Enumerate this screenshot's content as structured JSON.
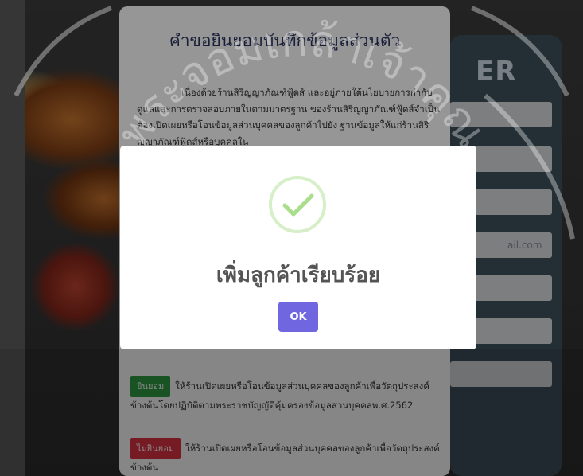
{
  "register": {
    "title": "ER",
    "email_partial": "ail.com"
  },
  "consent": {
    "title": "คำขอยินยอมบันทึกข้อมูลส่วนตัว",
    "body": "เนื่องด้วยร้านสิริญญาภัณฑ์ฟู้ดส์ และอยู่ภายใต้นโยบายการกำกับดูแลและการตรวจสอบภายในตามมาตรฐาน ของร้านสิริญญาภัณฑ์ฟู้ดส์จำเป็นต้องเปิดเผยหรือโอนข้อมูลส่วนบุคคลของลูกค้าไปยัง ฐานข้อมูลให้แก่ร้านสิริญญาภัณฑ์ฟู้ดส์หรือบุคคลใน",
    "agree_label": "ยินยอม",
    "agree_text": "ให้ร้านเปิดเผยหรือโอนข้อมูลส่วนบุคคลของลูกค้าเพื่อวัตถุประสงค์ข้างต้นโดยปฏิบัติตามพระราชบัญญัติคุ้มครองข้อมูลส่วนบุคคลพ.ศ.2562",
    "decline_label": "ไม่ยินยอม",
    "decline_text": "ให้ร้านเปิดเผยหรือโอนข้อมูลส่วนบุคคลของลูกค้าเพื่อวัตถุประสงค์ข้างต้น"
  },
  "dialog": {
    "title": "เพิ่มลูกค้าเรียบร้อย",
    "ok_label": "OK",
    "icon": "success-check-icon"
  },
  "watermark": {
    "text": "พระจอมเกล้าเจ้าคุณ"
  },
  "colors": {
    "ok_button": "#7066e0",
    "success": "#a5dc86",
    "agree": "#2f9b41",
    "decline": "#dc3545",
    "register_card": "#3b4d59",
    "consent_title": "#2c3560"
  }
}
